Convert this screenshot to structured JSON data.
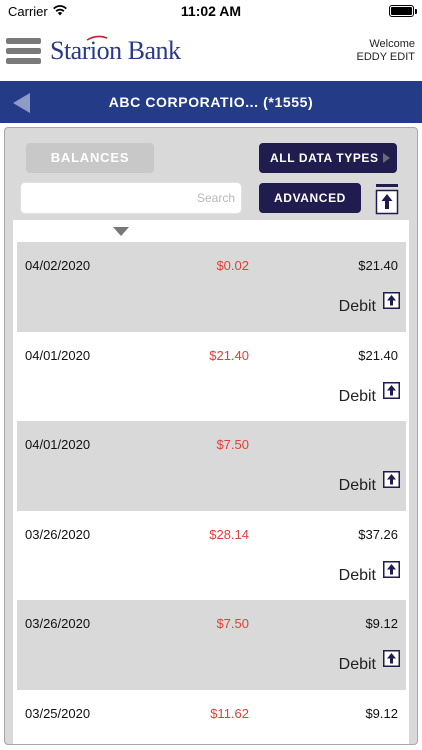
{
  "status": {
    "carrier": "Carrier",
    "time": "11:02 AM"
  },
  "header": {
    "logo_text": "Starion Bank",
    "welcome": "Welcome",
    "user": "EDDY EDIT"
  },
  "titlebar": {
    "title": "ABC CORPORATIO...  (*1555)"
  },
  "controls": {
    "balances_label": "BALANCES",
    "data_types_label": "ALL DATA TYPES",
    "search_placeholder": "Search",
    "advanced_label": "ADVANCED"
  },
  "transactions": [
    {
      "date": "04/02/2020",
      "amount": "$0.02",
      "balance": "$21.40",
      "type": "Debit"
    },
    {
      "date": "04/01/2020",
      "amount": "$21.40",
      "balance": "$21.40",
      "type": "Debit"
    },
    {
      "date": "04/01/2020",
      "amount": "$7.50",
      "balance": "",
      "type": "Debit"
    },
    {
      "date": "03/26/2020",
      "amount": "$28.14",
      "balance": "$37.26",
      "type": "Debit"
    },
    {
      "date": "03/26/2020",
      "amount": "$7.50",
      "balance": "$9.12",
      "type": "Debit"
    },
    {
      "date": "03/25/2020",
      "amount": "$11.62",
      "balance": "$9.12",
      "type": ""
    }
  ],
  "colors": {
    "brand_blue": "#243c88",
    "dark_button": "#201c4e",
    "amount_red": "#e0403a",
    "row_shade": "#d9d9d9"
  }
}
